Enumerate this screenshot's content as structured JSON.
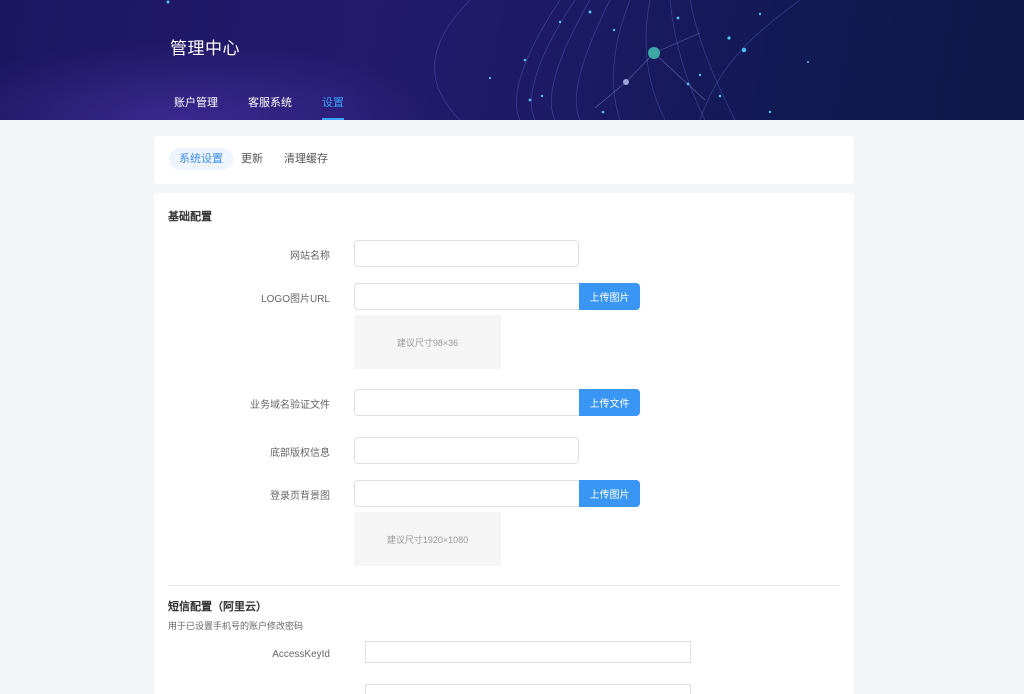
{
  "header": {
    "title": "管理中心",
    "nav": [
      {
        "label": "账户管理"
      },
      {
        "label": "客服系统"
      },
      {
        "label": "设置"
      }
    ],
    "active_nav": "设置"
  },
  "sub_tabs": [
    {
      "label": "系统设置"
    },
    {
      "label": "更新"
    },
    {
      "label": "清理缓存"
    }
  ],
  "basic_config": {
    "title": "基础配置",
    "site_name_label": "网站名称",
    "site_name_value": "",
    "logo_label": "LOGO图片URL",
    "logo_value": "",
    "logo_upload": "上传图片",
    "logo_hint": "建议尺寸98×36",
    "domain_file_label": "业务域名验证文件",
    "domain_file_value": "",
    "domain_file_upload": "上传文件",
    "copyright_label": "底部版权信息",
    "copyright_value": "",
    "login_bg_label": "登录页背景图",
    "login_bg_value": "",
    "login_bg_upload": "上传图片",
    "login_bg_hint": "建议尺寸1920×1080"
  },
  "sms_config": {
    "title": "短信配置（阿里云）",
    "description": "用于已设置手机号的账户修改密码",
    "access_key_label": "AccessKeyId",
    "access_key_value": ""
  },
  "colors": {
    "accent": "#3a96f4",
    "header_dark": "#1c1660",
    "page_bg": "#f4f5f7"
  }
}
